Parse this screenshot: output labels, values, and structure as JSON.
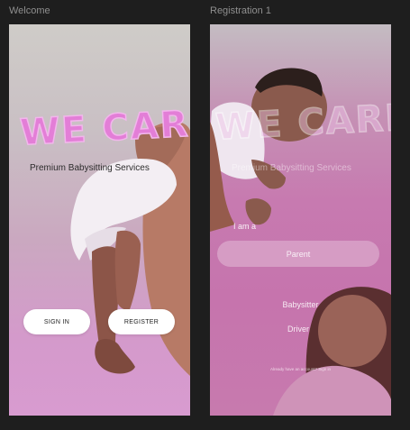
{
  "canvas": {
    "background": "#1e1e1e"
  },
  "frames": [
    {
      "label": "Welcome"
    },
    {
      "label": "Registration 1"
    }
  ],
  "welcome": {
    "logo_text": "WE CARE",
    "tagline": "Premium Babysitting Services",
    "signin_label": "SIGN IN",
    "register_label": "REGISTER"
  },
  "registration": {
    "logo_text": "WE CARE",
    "tagline": "Premium Babysitting Services",
    "role_prompt": "I am a",
    "roles": [
      {
        "label": "Parent",
        "selected": true
      },
      {
        "label": "Babysitter",
        "selected": false
      },
      {
        "label": "Driver",
        "selected": false
      }
    ],
    "footer_link": "Already have an account? Sign in"
  },
  "colors": {
    "brand_pink": "#e37ed7",
    "button_bg": "#ffffff",
    "frame_label": "#8f8f8f"
  }
}
